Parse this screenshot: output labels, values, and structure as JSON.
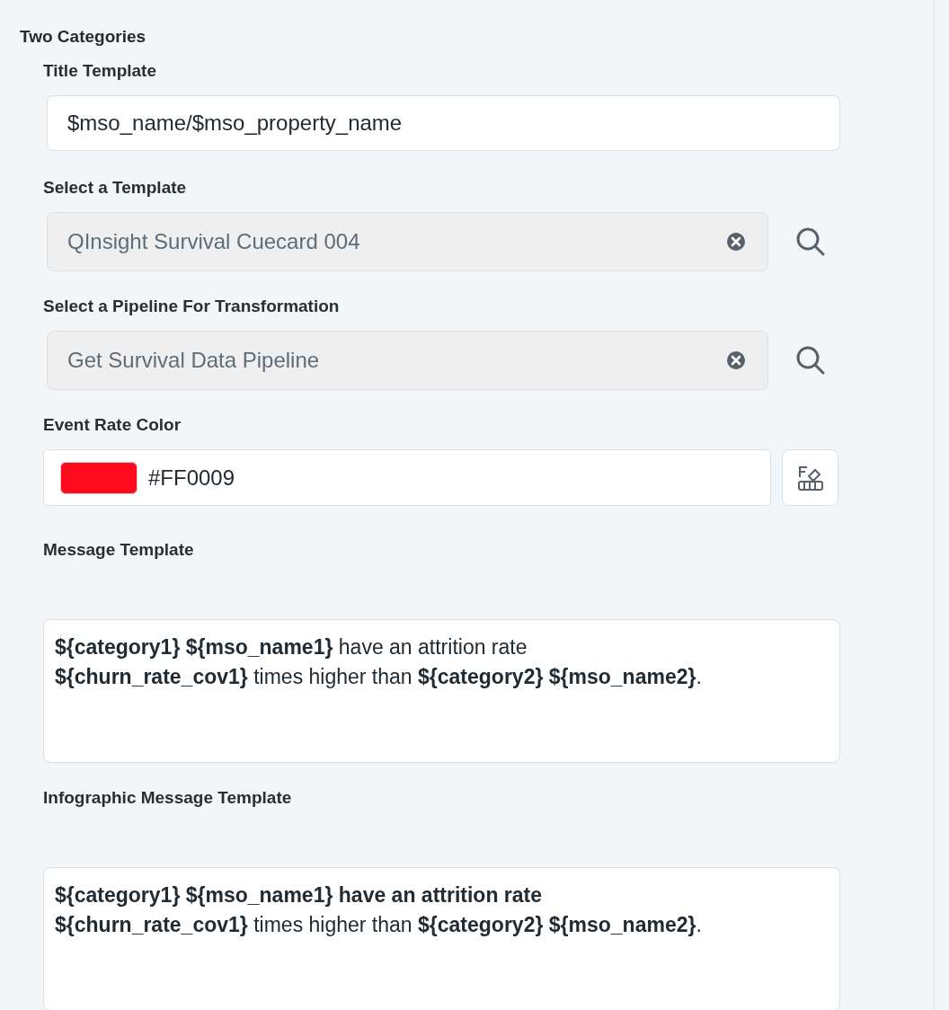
{
  "section": {
    "title": "Two Categories"
  },
  "fields": [
    {
      "kind": "text",
      "label": "Title Template",
      "value": "$mso_name/$mso_property_name"
    },
    {
      "kind": "lookup",
      "label": "Select a Template",
      "value": "QInsight Survival Cuecard 004"
    },
    {
      "kind": "lookup",
      "label": "Select a Pipeline For Transformation",
      "value": "Get Survival Data Pipeline"
    },
    {
      "kind": "color",
      "label": "Event Rate Color",
      "value": "#FF0009",
      "color": "#ff0a1f"
    },
    {
      "kind": "message",
      "label": "Message Template",
      "value": "**${category1} ${mso_name1}** have an attrition rate\n**${churn_rate_cov1}** times higher than **${category2} ${mso_name2}**."
    },
    {
      "kind": "message",
      "label": "Infographic Message Template",
      "value": "**${category1} ${mso_name1} have an attrition rate**\n**${churn_rate_cov1}** times higher than **${category2} ${mso_name2}**."
    }
  ]
}
